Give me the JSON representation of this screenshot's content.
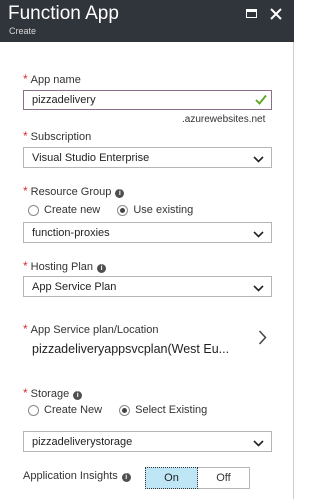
{
  "header": {
    "title": "Function App",
    "subtitle": "Create"
  },
  "app_name": {
    "label": "App name",
    "value": "pizzadelivery",
    "suffix": ".azurewebsites.net"
  },
  "subscription": {
    "label": "Subscription",
    "selected": "Visual Studio Enterprise"
  },
  "resource_group": {
    "label": "Resource Group",
    "options": [
      "Create new",
      "Use existing"
    ],
    "selected_option": "Use existing",
    "selected": "function-proxies"
  },
  "hosting_plan": {
    "label": "Hosting Plan",
    "selected": "App Service Plan"
  },
  "app_service_plan": {
    "label": "App Service plan/Location",
    "value": "pizzadeliveryappsvcplan(West Eu..."
  },
  "storage": {
    "label": "Storage",
    "options": [
      "Create New",
      "Select Existing"
    ],
    "selected_option": "Select Existing",
    "selected": "pizzadeliverystorage"
  },
  "application_insights": {
    "label": "Application Insights",
    "on_label": "On",
    "off_label": "Off",
    "selected": "On"
  },
  "colors": {
    "header_bg": "#30343b",
    "required": "#d9302c",
    "valid_check": "#5ba51e",
    "toggle_on": "#bfe6f5"
  }
}
